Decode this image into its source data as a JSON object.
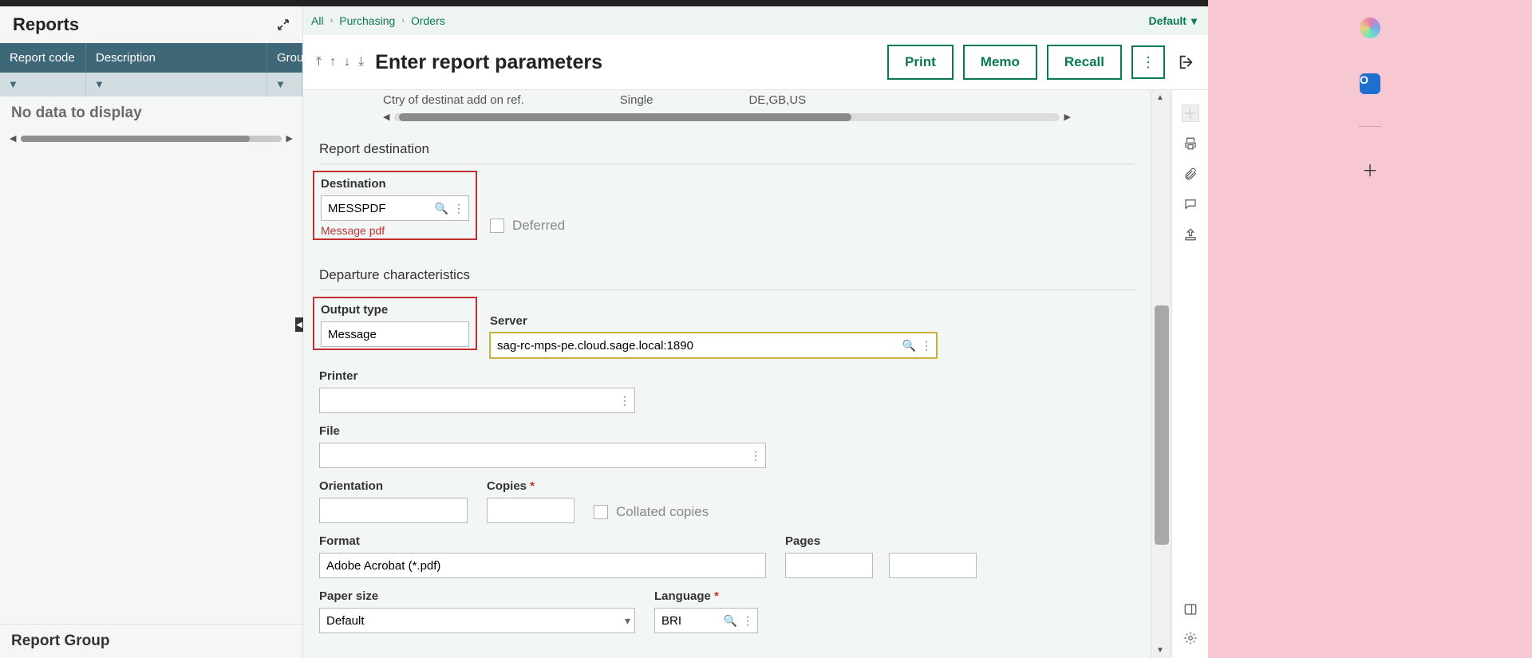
{
  "leftPanel": {
    "title": "Reports",
    "columns": {
      "c1": "Report code",
      "c2": "Description",
      "c3": "Grou"
    },
    "noData": "No data to display",
    "bottomTitle": "Report Group"
  },
  "breadcrumb": {
    "c1": "All",
    "c2": "Purchasing",
    "c3": "Orders",
    "default": "Default"
  },
  "titleBar": {
    "title": "Enter report parameters",
    "print": "Print",
    "memo": "Memo",
    "recall": "Recall"
  },
  "prevFrag": {
    "a": "Ctry of destinat add on ref.",
    "b": "Single",
    "c": "DE,GB,US"
  },
  "sections": {
    "reportDest": "Report destination",
    "depChar": "Departure characteristics"
  },
  "fields": {
    "destination": {
      "label": "Destination",
      "value": "MESSPDF",
      "hint": "Message pdf"
    },
    "deferred": "Deferred",
    "outputType": {
      "label": "Output type",
      "value": "Message"
    },
    "server": {
      "label": "Server",
      "value": "sag-rc-mps-pe.cloud.sage.local:1890"
    },
    "printer": {
      "label": "Printer",
      "value": ""
    },
    "file": {
      "label": "File",
      "value": ""
    },
    "orientation": {
      "label": "Orientation",
      "value": ""
    },
    "copies": {
      "label": "Copies",
      "value": ""
    },
    "collated": "Collated copies",
    "format": {
      "label": "Format",
      "value": "Adobe Acrobat (*.pdf)"
    },
    "pages": {
      "label": "Pages",
      "value1": "",
      "value2": ""
    },
    "paperSize": {
      "label": "Paper size",
      "value": "Default"
    },
    "language": {
      "label": "Language",
      "value": "BRI"
    }
  }
}
